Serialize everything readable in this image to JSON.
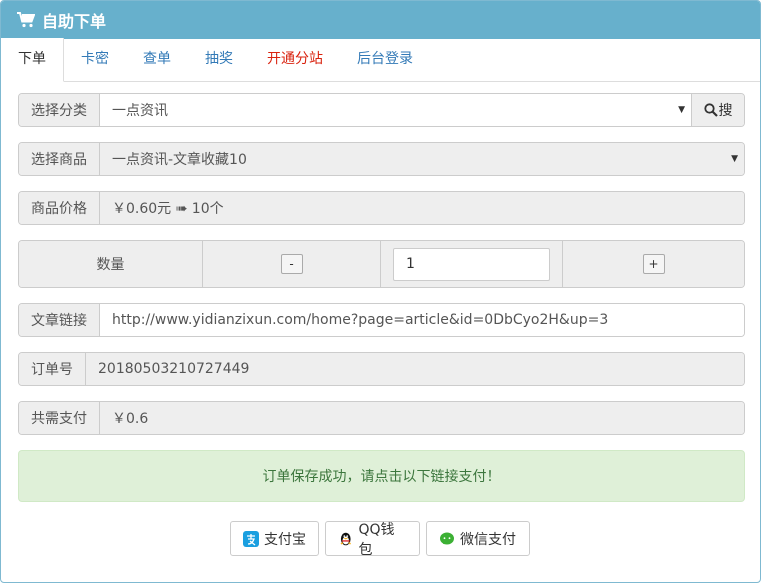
{
  "header": {
    "title": "自助下单"
  },
  "tabs": [
    {
      "label": "下单"
    },
    {
      "label": "卡密"
    },
    {
      "label": "查单"
    },
    {
      "label": "抽奖"
    },
    {
      "label": "开通分站"
    },
    {
      "label": "后台登录"
    }
  ],
  "form": {
    "category": {
      "label": "选择分类",
      "value": "一点资讯",
      "search_label": "搜"
    },
    "product": {
      "label": "选择商品",
      "value": "一点资讯-文章收藏10"
    },
    "price": {
      "label": "商品价格",
      "value": "￥0.60元 ➠ 10个"
    },
    "quantity": {
      "label": "数量",
      "minus": "-",
      "value": "1",
      "plus": "+"
    },
    "link": {
      "label": "文章链接",
      "value": "http://www.yidianzixun.com/home?page=article&id=0DbCyo2H&up=3"
    },
    "order": {
      "label": "订单号",
      "value": "20180503210727449"
    },
    "total": {
      "label": "共需支付",
      "value": "￥0.6"
    }
  },
  "alert": {
    "text": "订单保存成功，请点击以下链接支付！"
  },
  "payment": {
    "alipay": "支付宝",
    "qq": "QQ钱包",
    "wechat": "微信支付"
  },
  "colors": {
    "header_bg": "#67b0cc",
    "link": "#337ab7",
    "tab_highlight": "#d9230f",
    "alert_bg": "#dff0d8",
    "alert_text": "#3c763d",
    "alipay": "#1a9fe0",
    "wechat": "#3cb034"
  }
}
